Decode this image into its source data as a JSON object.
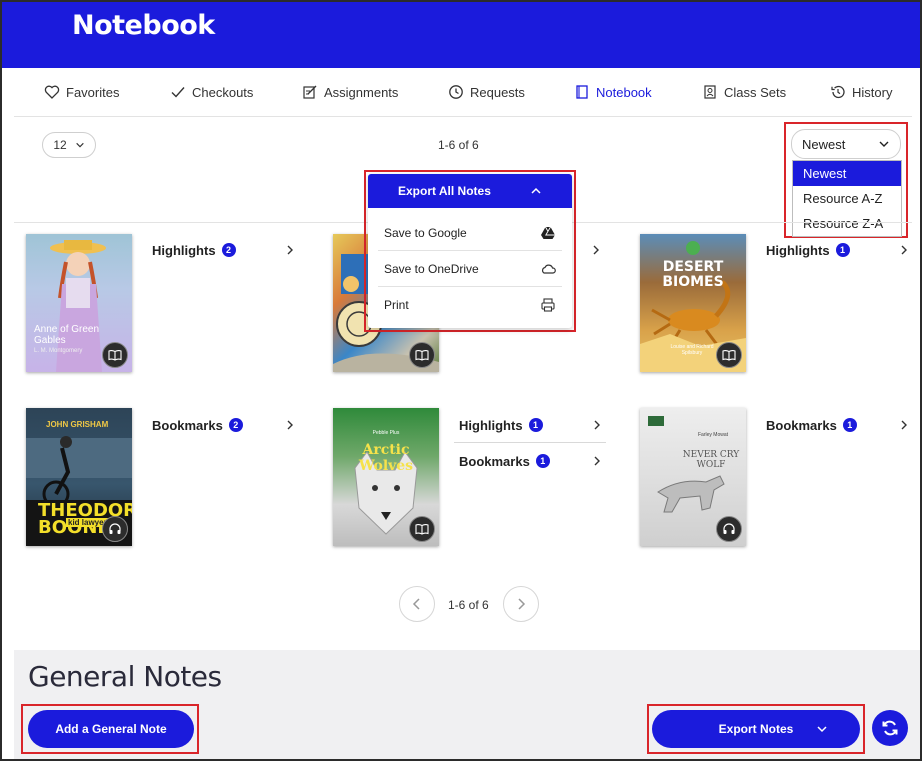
{
  "app": {
    "title": "Notebook"
  },
  "nav": {
    "items": [
      {
        "label": "Favorites",
        "icon": "heart-icon"
      },
      {
        "label": "Checkouts",
        "icon": "check-icon"
      },
      {
        "label": "Assignments",
        "icon": "assignment-icon"
      },
      {
        "label": "Requests",
        "icon": "clock-icon"
      },
      {
        "label": "Notebook",
        "icon": "notebook-icon",
        "active": true
      },
      {
        "label": "Class Sets",
        "icon": "class-sets-icon"
      },
      {
        "label": "History",
        "icon": "history-icon"
      }
    ]
  },
  "toolbar": {
    "per_page": "12",
    "range": "1-6 of 6",
    "sort": {
      "selected": "Newest",
      "options": [
        "Newest",
        "Resource A-Z",
        "Resource Z-A"
      ]
    }
  },
  "export_menu": {
    "title": "Export All Notes",
    "items": [
      {
        "label": "Save to Google",
        "icon": "google-drive-icon"
      },
      {
        "label": "Save to OneDrive",
        "icon": "onedrive-icon"
      },
      {
        "label": "Print",
        "icon": "printer-icon"
      }
    ]
  },
  "books": [
    {
      "cover_title": "Anne of Green Gables",
      "cover_author": "L. M. Montgomery",
      "notes": [
        {
          "label": "Highlights",
          "count": "2"
        }
      ]
    },
    {
      "cover_title": "",
      "cover_author": "",
      "notes": []
    },
    {
      "cover_title": "DESERT BIOMES",
      "cover_author": "Louise and Richard Spilsbury",
      "notes": [
        {
          "label": "Highlights",
          "count": "1"
        }
      ]
    },
    {
      "cover_title": "THEODORE BOONE",
      "cover_subtitle": "kid lawyer",
      "cover_author": "JOHN GRISHAM",
      "notes": [
        {
          "label": "Bookmarks",
          "count": "2"
        }
      ]
    },
    {
      "cover_title": "Arctic Wolves",
      "cover_author": "Pebble Plus",
      "notes": [
        {
          "label": "Highlights",
          "count": "1"
        },
        {
          "label": "Bookmarks",
          "count": "1"
        }
      ]
    },
    {
      "cover_title": "NEVER CRY WOLF",
      "cover_author": "Farley Mowat",
      "notes": [
        {
          "label": "Bookmarks",
          "count": "1"
        }
      ]
    }
  ],
  "pager": {
    "range": "1-6 of 6"
  },
  "general_notes": {
    "title": "General Notes",
    "add_label": "Add a General Note",
    "export_label": "Export Notes"
  },
  "colors": {
    "brand": "#1b1bdc",
    "highlight": "#d9252a"
  }
}
